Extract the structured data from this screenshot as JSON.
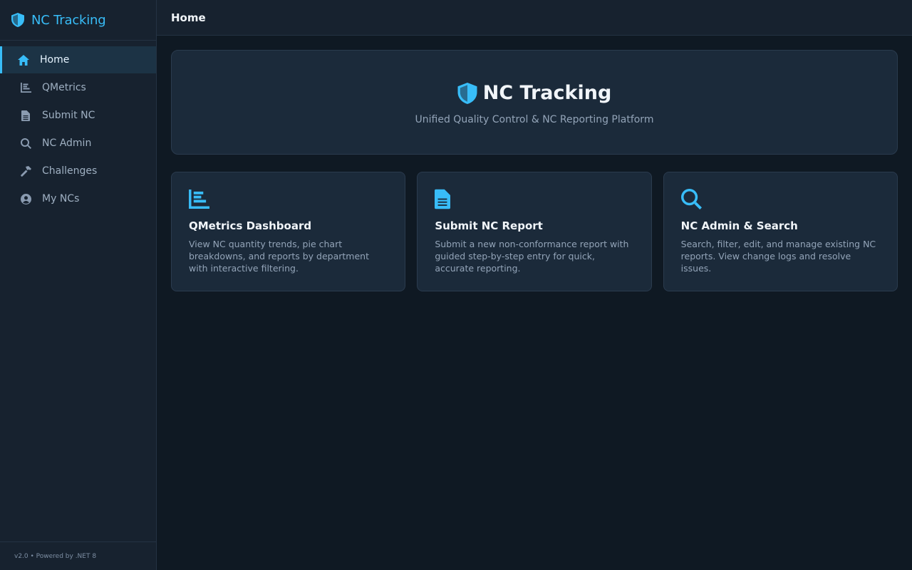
{
  "brand": {
    "name": "NC Tracking",
    "icon": "shield-icon"
  },
  "nav": {
    "items": [
      {
        "label": "Home",
        "icon": "home-icon",
        "active": true
      },
      {
        "label": "QMetrics",
        "icon": "chart-icon",
        "active": false
      },
      {
        "label": "Submit NC",
        "icon": "document-icon",
        "active": false
      },
      {
        "label": "NC Admin",
        "icon": "search-icon",
        "active": false
      },
      {
        "label": "Challenges",
        "icon": "hammer-icon",
        "active": false
      },
      {
        "label": "My NCs",
        "icon": "user-circle-icon",
        "active": false
      }
    ]
  },
  "footer": {
    "text": "v2.0 • Powered by .NET 8"
  },
  "topbar": {
    "title": "Home"
  },
  "hero": {
    "title": "NC Tracking",
    "subtitle": "Unified Quality Control & NC Reporting Platform"
  },
  "cards": [
    {
      "icon": "chart-icon",
      "title": "QMetrics Dashboard",
      "description": "View NC quantity trends, pie chart breakdowns, and reports by department with interactive filtering."
    },
    {
      "icon": "document-icon",
      "title": "Submit NC Report",
      "description": "Submit a new non-conformance report with guided step-by-step entry for quick, accurate reporting."
    },
    {
      "icon": "search-icon",
      "title": "NC Admin & Search",
      "description": "Search, filter, edit, and manage existing NC reports. View change logs and resolve issues."
    }
  ],
  "colors": {
    "accent": "#38bdf8",
    "background": "#0f1923",
    "panel": "#17222f",
    "card": "#1b2a3a"
  }
}
